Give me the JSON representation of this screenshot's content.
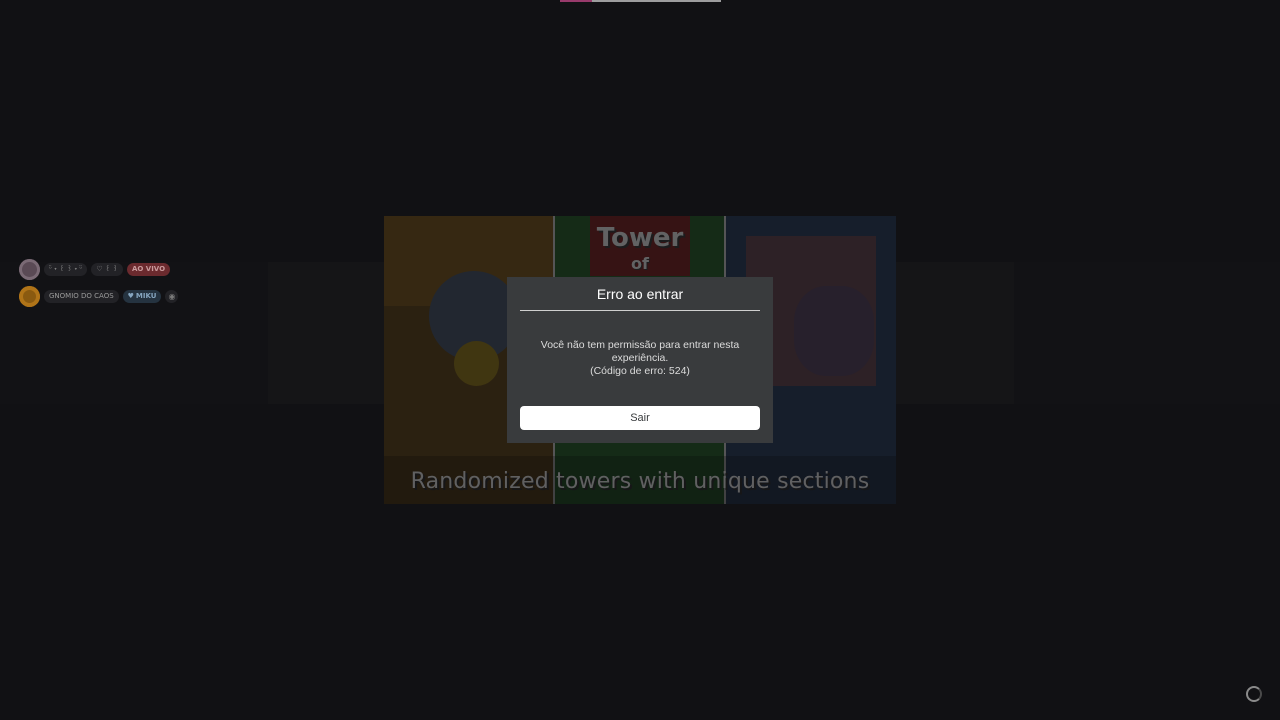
{
  "loading": {
    "progress": 0.2
  },
  "thumbnail": {
    "title_line1": "Tower",
    "title_line2": "of",
    "caption": "Randomized towers with unique sections"
  },
  "dialog": {
    "title": "Erro ao entrar",
    "message_line1": "Você não tem permissão para entrar nesta experiência.",
    "message_line2": "(Código de erro: 524)",
    "leave_button": "Sair"
  },
  "feed": [
    {
      "name": "ᵕ̈ ˖ ꒰ ꒱ ˖ ᵕ̈",
      "badge": "♡ ꒰ ꒱",
      "status": "AO VIVO",
      "avatar_icon": "user-avatar-icon"
    },
    {
      "name": "GNOMIO DO CAOS",
      "badge": "MIKU",
      "status": "",
      "avatar_icon": "user-avatar-icon"
    }
  ],
  "colors": {
    "background": "#111114",
    "dialog": "#393b3d",
    "accent_pink": "#e0509a",
    "live_badge": "#6b2a2e"
  }
}
